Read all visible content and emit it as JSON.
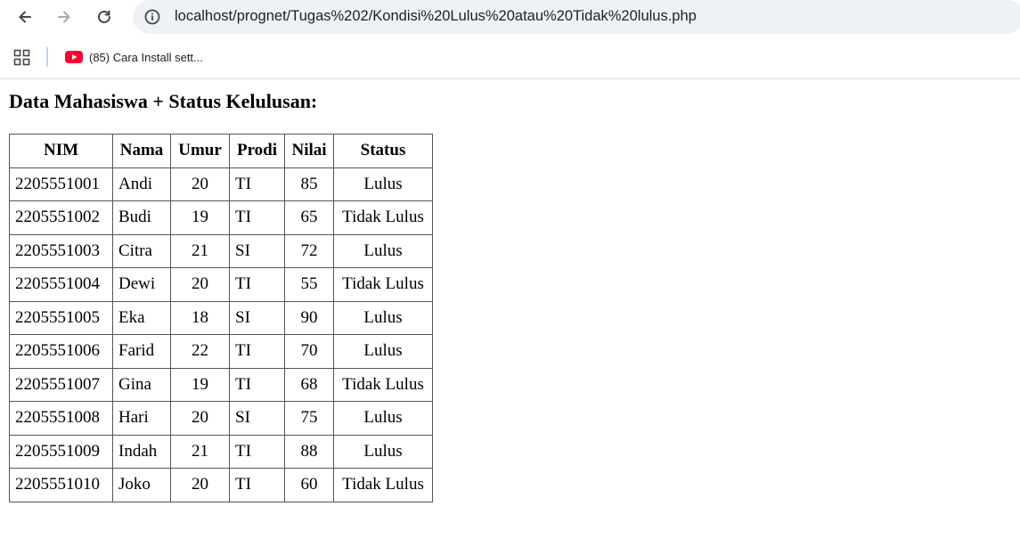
{
  "browser": {
    "url": "localhost/prognet/Tugas%202/Kondisi%20Lulus%20atau%20Tidak%20lulus.php",
    "bookmarks": [
      {
        "label": "(85) Cara Install sett...",
        "icon": "youtube-icon"
      }
    ],
    "icons": {
      "back": "back-arrow-icon",
      "forward": "forward-arrow-icon",
      "reload": "reload-icon",
      "site_info": "info-icon",
      "apps": "apps-grid-icon"
    }
  },
  "page": {
    "title": "Data Mahasiswa + Status Kelulusan:",
    "table": {
      "headers": {
        "nim": "NIM",
        "nama": "Nama",
        "umur": "Umur",
        "prodi": "Prodi",
        "nilai": "Nilai",
        "status": "Status"
      },
      "rows": [
        {
          "nim": "2205551001",
          "nama": "Andi",
          "umur": "20",
          "prodi": "TI",
          "nilai": "85",
          "status": "Lulus"
        },
        {
          "nim": "2205551002",
          "nama": "Budi",
          "umur": "19",
          "prodi": "TI",
          "nilai": "65",
          "status": "Tidak Lulus"
        },
        {
          "nim": "2205551003",
          "nama": "Citra",
          "umur": "21",
          "prodi": "SI",
          "nilai": "72",
          "status": "Lulus"
        },
        {
          "nim": "2205551004",
          "nama": "Dewi",
          "umur": "20",
          "prodi": "TI",
          "nilai": "55",
          "status": "Tidak Lulus"
        },
        {
          "nim": "2205551005",
          "nama": "Eka",
          "umur": "18",
          "prodi": "SI",
          "nilai": "90",
          "status": "Lulus"
        },
        {
          "nim": "2205551006",
          "nama": "Farid",
          "umur": "22",
          "prodi": "TI",
          "nilai": "70",
          "status": "Lulus"
        },
        {
          "nim": "2205551007",
          "nama": "Gina",
          "umur": "19",
          "prodi": "TI",
          "nilai": "68",
          "status": "Tidak Lulus"
        },
        {
          "nim": "2205551008",
          "nama": "Hari",
          "umur": "20",
          "prodi": "SI",
          "nilai": "75",
          "status": "Lulus"
        },
        {
          "nim": "2205551009",
          "nama": "Indah",
          "umur": "21",
          "prodi": "TI",
          "nilai": "88",
          "status": "Lulus"
        },
        {
          "nim": "2205551010",
          "nama": "Joko",
          "umur": "20",
          "prodi": "TI",
          "nilai": "60",
          "status": "Tidak Lulus"
        }
      ]
    }
  }
}
